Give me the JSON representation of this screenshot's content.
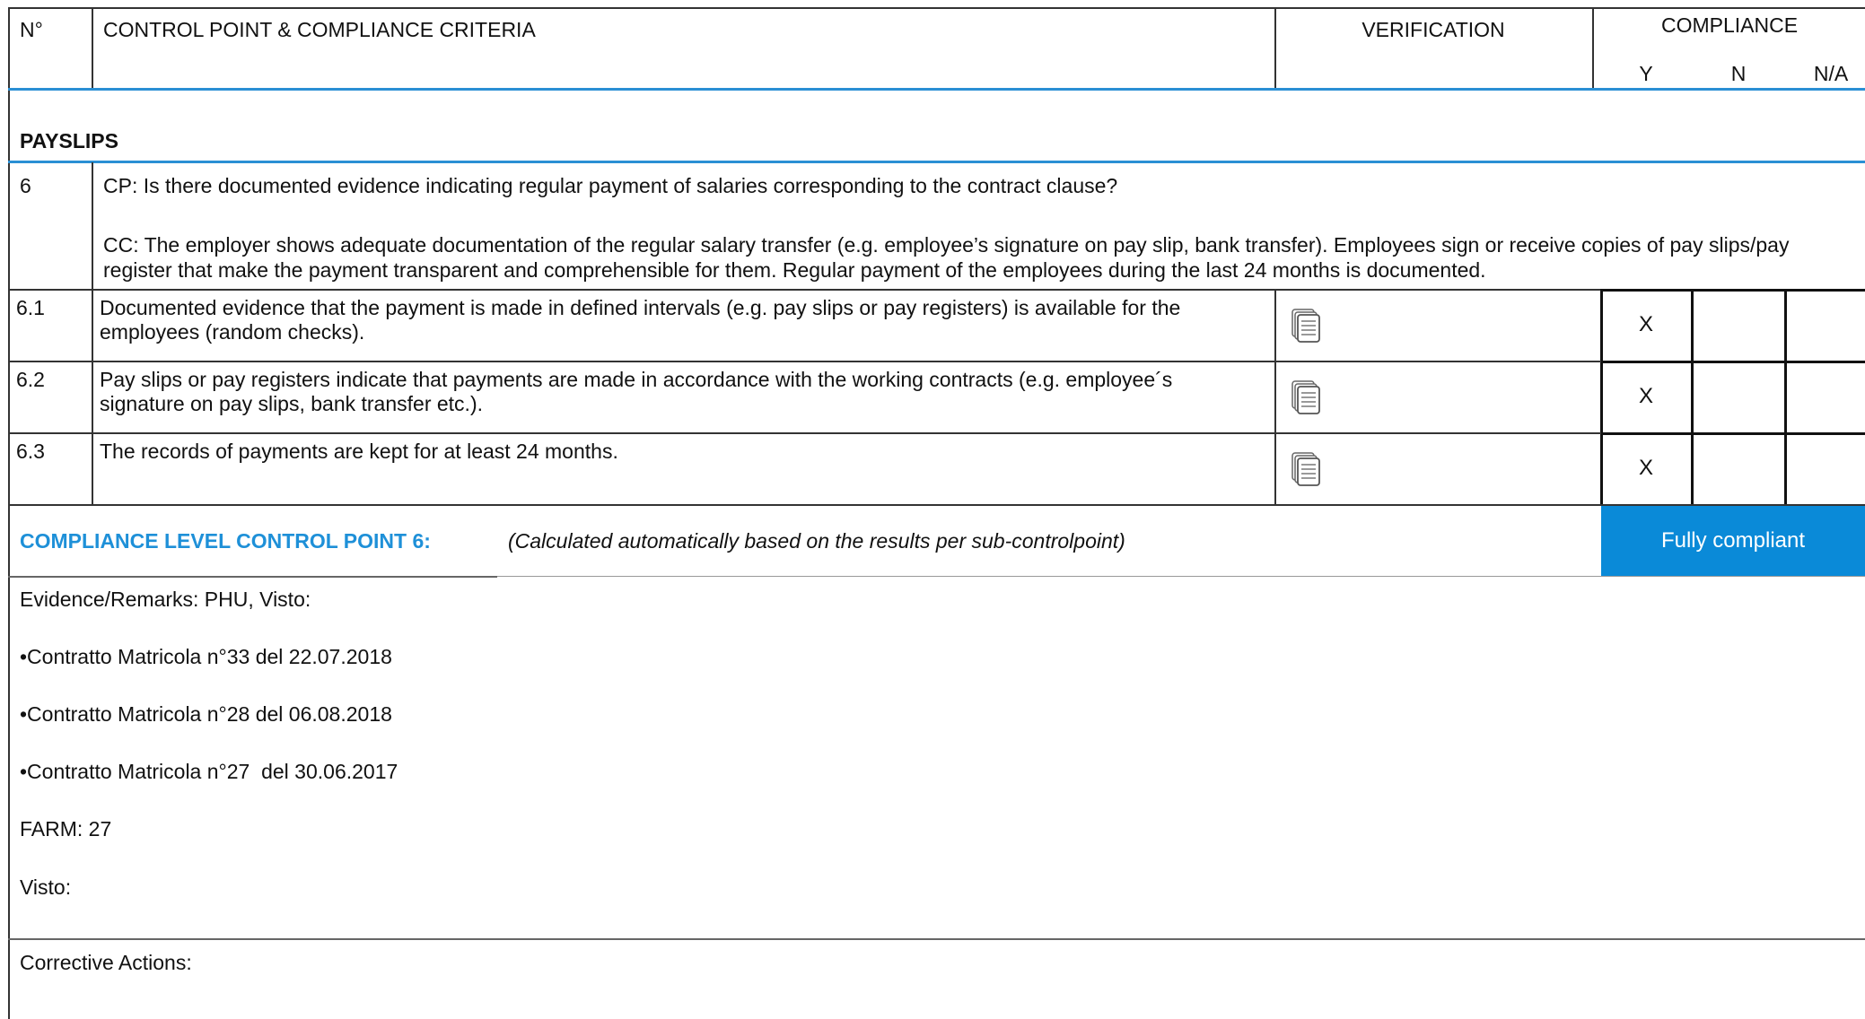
{
  "header": {
    "num": "N°",
    "criteria": "CONTROL POINT & COMPLIANCE CRITERIA",
    "verification": "VERIFICATION",
    "compliance": "COMPLIANCE",
    "y": "Y",
    "n": "N",
    "na": "N/A"
  },
  "section": {
    "title": "PAYSLIPS",
    "num": "6",
    "cp": "CP: Is there documented evidence indicating regular payment of salaries corresponding to the contract clause?",
    "cc_line1": "CC: The employer shows adequate documentation of the regular salary transfer (e.g. employee’s signature on pay slip, bank transfer). Employees sign or receive copies of pay slips/pay",
    "cc_line2": "register that make the payment transparent and comprehensible for them. Regular payment of the employees during the last 24 months is documented."
  },
  "rows": [
    {
      "num": "6.1",
      "line1": "Documented evidence that the payment is made in defined intervals (e.g. pay slips or pay registers) is available for the",
      "line2": "employees (random checks).",
      "y": "X",
      "n": "",
      "na": ""
    },
    {
      "num": "6.2",
      "line1": "Pay slips or pay registers indicate that payments are made in accordance with the working contracts (e.g. employee´s",
      "line2": "signature on pay slips, bank transfer etc.).",
      "y": "X",
      "n": "",
      "na": ""
    },
    {
      "num": "6.3",
      "line1": "The records of payments are kept for at least 24 months.",
      "line2": "",
      "y": "X",
      "n": "",
      "na": ""
    }
  ],
  "compliance_level": {
    "label": "COMPLIANCE LEVEL CONTROL POINT 6:",
    "note": "(Calculated automatically based on the results per sub-controlpoint)",
    "result": "Fully compliant",
    "label_color": "#1e90d8",
    "result_bg": "#0a8ad8"
  },
  "evidence": {
    "title": "Evidence/Remarks: PHU, Visto:",
    "items": [
      "•Contratto Matricola n°33 del 22.07.2018",
      "•Contratto Matricola n°28 del 06.08.2018",
      "•Contratto Matricola n°27  del 30.06.2017"
    ],
    "farm": "FARM: 27",
    "visto": "Visto:"
  },
  "corrective": {
    "title": "Corrective Actions:"
  },
  "icons": {
    "verification": "document-stack-icon"
  }
}
